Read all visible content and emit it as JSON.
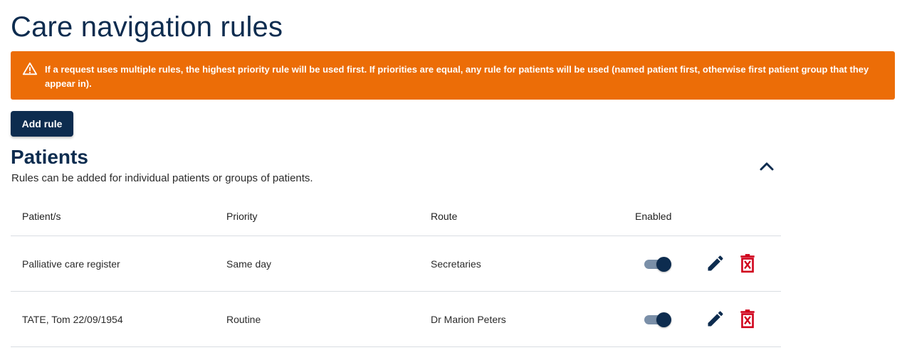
{
  "page": {
    "title": "Care navigation rules"
  },
  "warning": {
    "icon": "warning-triangle-icon",
    "text": "If a request uses multiple rules, the highest priority rule will be used first. If priorities are equal, any rule for patients will be used (named patient first, otherwise first patient group that they appear in).",
    "background_color": "#ec6d07"
  },
  "actions": {
    "add_rule_label": "Add rule"
  },
  "patients_section": {
    "heading": "Patients",
    "description": "Rules can be added for individual patients or groups of patients.",
    "collapse_icon": "chevron-up-icon",
    "columns": {
      "patient": "Patient/s",
      "priority": "Priority",
      "route": "Route",
      "enabled": "Enabled"
    },
    "rows": [
      {
        "patient": "Palliative care register",
        "priority": "Same day",
        "route": "Secretaries",
        "enabled": true
      },
      {
        "patient": "TATE, Tom 22/09/1954",
        "priority": "Routine",
        "route": "Dr Marion Peters",
        "enabled": true
      }
    ],
    "row_icons": {
      "edit": "pencil-icon",
      "delete": "trash-icon"
    }
  },
  "colors": {
    "primary": "#0d2c4f",
    "warning": "#ec6d07",
    "danger": "#d0021b",
    "toggle_track": "#7a8fa8"
  }
}
